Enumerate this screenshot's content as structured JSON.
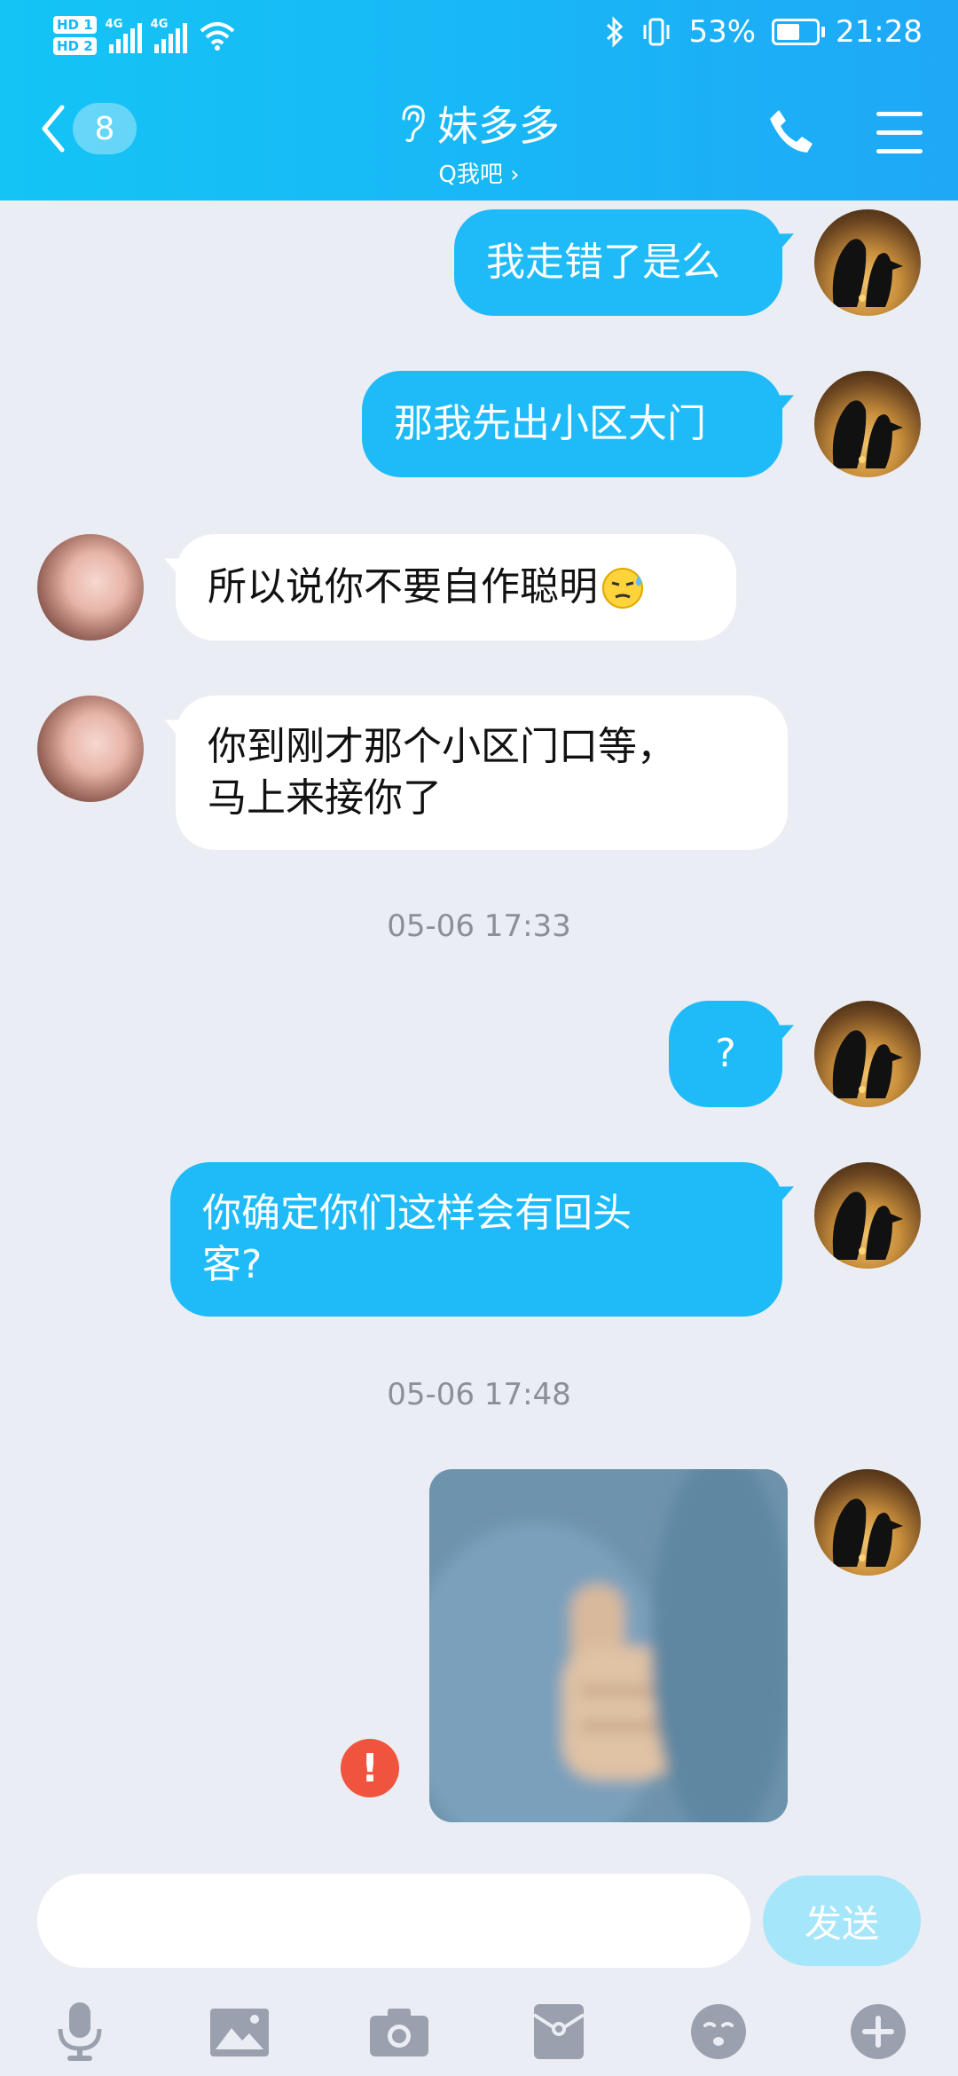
{
  "status_bar": {
    "sim1": "HD 1",
    "sim2": "HD 2",
    "network1": "4G",
    "network2": "4G",
    "battery": "53%",
    "battery_level": 0.53,
    "time": "21:28"
  },
  "header": {
    "unread_count": "8",
    "title": "妹多多",
    "subtitle": "Q我吧 ›"
  },
  "messages": [
    {
      "sender": "self",
      "text": "我走错了是么"
    },
    {
      "sender": "self",
      "text": "那我先出小区大门"
    },
    {
      "sender": "other",
      "text": "所以说你不要自作聪明"
    },
    {
      "sender": "other",
      "text_line1": "你到刚才那个小区门口等，",
      "text_line2": "马上来接你了"
    },
    {
      "type": "timestamp",
      "text": "05-06 17:33"
    },
    {
      "sender": "self",
      "text": "?"
    },
    {
      "sender": "self",
      "text_line1": "你确定你们这样会有回头",
      "text_line2": "客?"
    },
    {
      "type": "timestamp",
      "text": "05-06 17:48"
    },
    {
      "sender": "self",
      "type": "image",
      "status": "send-failed"
    }
  ],
  "error_mark": "!",
  "input": {
    "value": "",
    "placeholder": ""
  },
  "send_label": "发送",
  "toolbar": [
    "microphone-icon",
    "image-icon",
    "camera-icon",
    "red-packet-icon",
    "emoji-icon",
    "plus-icon"
  ],
  "colors": {
    "header": "#18b8f6",
    "outgoing_bubble": "#1ebbf8",
    "incoming_bubble": "#ffffff",
    "background": "#ebedf4",
    "send_button": "#a6e6fb",
    "error": "#f0543f"
  }
}
